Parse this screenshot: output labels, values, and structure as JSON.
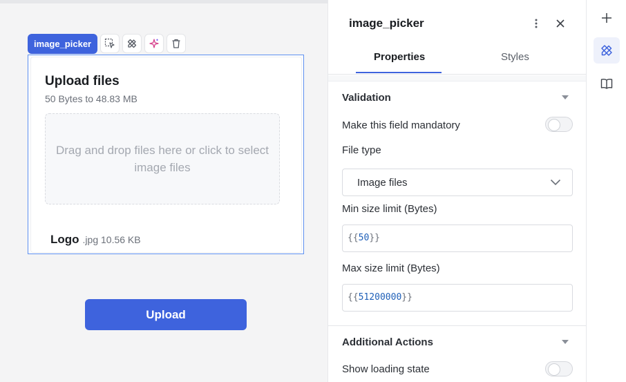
{
  "canvas": {
    "widget_tag": "image_picker",
    "toolbar_icons": [
      "select-parent-icon",
      "edit-tools-icon",
      "ai-sparkle-icon",
      "trash-icon"
    ],
    "picker": {
      "title": "Upload files",
      "size_range": "50 Bytes to 48.83 MB",
      "dropzone_text": "Drag and drop files here or click to select image files",
      "file_name": "Logo",
      "file_meta": ".jpg 10.56 KB"
    },
    "upload_button": "Upload"
  },
  "panel": {
    "title": "image_picker",
    "tabs": [
      {
        "label": "Properties",
        "active": true
      },
      {
        "label": "Styles",
        "active": false
      }
    ],
    "validation": {
      "heading": "Validation",
      "mandatory_label": "Make this field mandatory",
      "mandatory_on": false,
      "file_type_label": "File type",
      "file_type_value": "Image files",
      "min_label": "Min size limit (Bytes)",
      "min_value": "50",
      "max_label": "Max size limit (Bytes)",
      "max_value": "51200000"
    },
    "additional": {
      "heading": "Additional Actions",
      "loading_label": "Show loading state",
      "loading_on": false
    }
  },
  "rail": {
    "items": [
      {
        "icon": "plus-icon",
        "active": false
      },
      {
        "icon": "edit-tools-icon",
        "active": true
      },
      {
        "icon": "book-icon",
        "active": false
      }
    ]
  },
  "colors": {
    "accent": "#3e63dd",
    "selection_border": "#5b8ef0",
    "code_number": "#1e5fb8"
  }
}
